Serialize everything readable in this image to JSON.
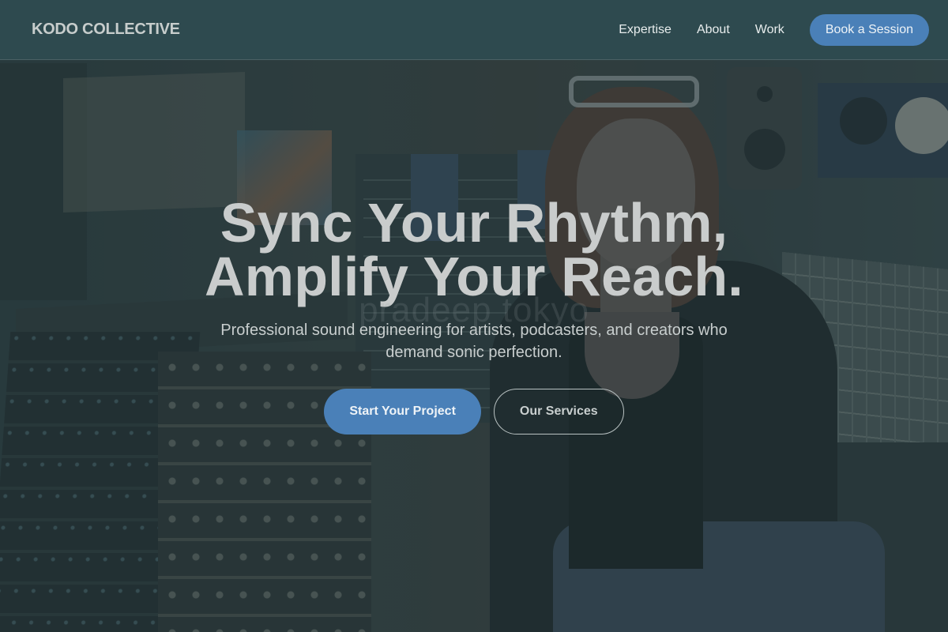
{
  "nav": {
    "brand": "KODO COLLECTIVE",
    "links": [
      {
        "label": "Expertise"
      },
      {
        "label": "About"
      },
      {
        "label": "Work"
      }
    ],
    "cta_label": "Book a Session"
  },
  "hero": {
    "title_line1": "Sync Your Rhythm,",
    "title_line2": "Amplify Your Reach.",
    "watermark": "pradeep tokyo",
    "subtitle": "Professional sound engineering for artists, podcasters, and creators who demand sonic perfection.",
    "primary_cta": "Start Your Project",
    "secondary_cta": "Our Services",
    "background_image": "recording-studio-engineer-photo"
  },
  "colors": {
    "accent": "#4a80b8",
    "navbar": "#2e4a4f",
    "overlay": "#263a3e",
    "text_light": "#c9cccc"
  }
}
